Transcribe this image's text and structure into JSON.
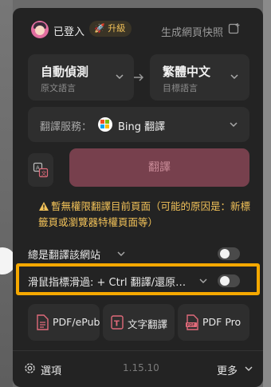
{
  "header": {
    "login_status": "已登入",
    "upgrade_label": "升級",
    "snapshot_label": "生成網頁快照"
  },
  "languages": {
    "source": {
      "name": "自動偵測",
      "sub": "原文語言"
    },
    "target": {
      "name": "繁體中文",
      "sub": "目標語言"
    }
  },
  "service": {
    "label": "翻譯服務：",
    "value": "Bing 翻譯"
  },
  "actions": {
    "translate_label": "翻譯"
  },
  "warning": {
    "text": "暫無權限翻譯目前頁面（可能的原因是：新標籤頁或瀏覽器特權頁面等）"
  },
  "options": {
    "always_translate": {
      "label": "總是翻譯該網站",
      "enabled": false
    },
    "hover_translate": {
      "label": "滑鼠指標滑過:  + Ctrl 翻譯/還原…",
      "enabled": false
    }
  },
  "tools": [
    {
      "label": "PDF/ePub",
      "icon": "pdf-file-icon"
    },
    {
      "label": "文字翻譯",
      "icon": "text-translate-icon"
    },
    {
      "label": "PDF Pro",
      "icon": "pdf-pro-icon"
    }
  ],
  "footer": {
    "settings_label": "選項",
    "version": "1.15.10",
    "more_label": "更多"
  },
  "colors": {
    "panel": "#232323",
    "accent_warning": "#f2c259",
    "translate_button": "#77404d",
    "highlight": "#f5a800"
  }
}
